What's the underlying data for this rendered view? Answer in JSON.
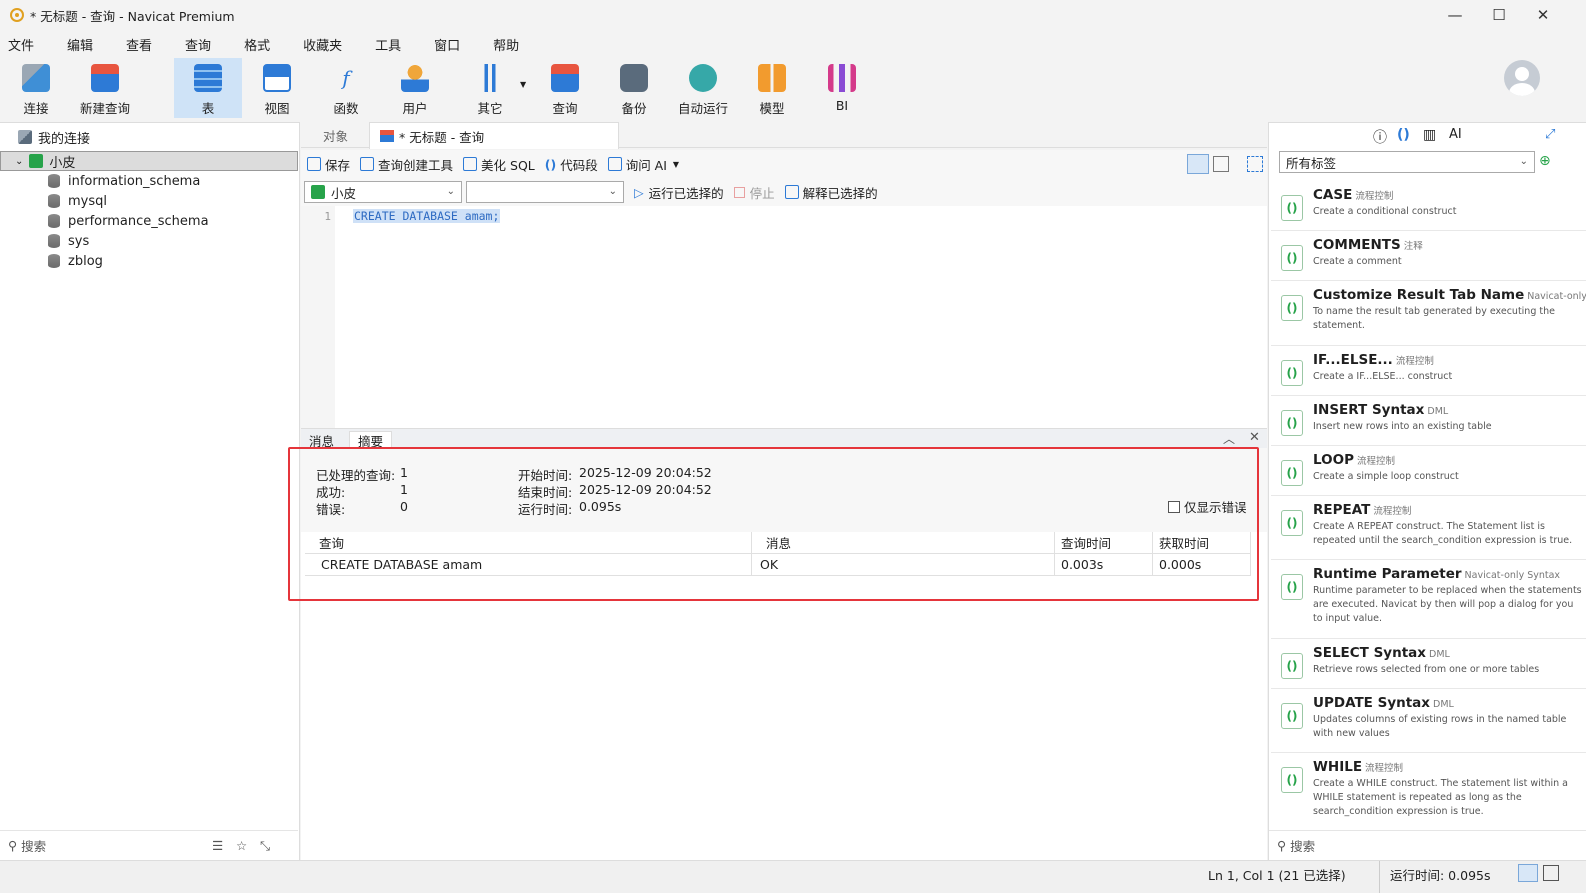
{
  "window": {
    "title": "* 无标题 - 查询 - Navicat Premium",
    "minimize": "—",
    "maximize": "☐",
    "close": "✕"
  },
  "menu": [
    "文件",
    "编辑",
    "查看",
    "查询",
    "格式",
    "收藏夹",
    "工具",
    "窗口",
    "帮助"
  ],
  "toolbar": [
    {
      "label": "连接",
      "color": "#3f8fd6"
    },
    {
      "label": "新建查询",
      "color": "#e8553f"
    },
    {
      "label": "表",
      "color": "#2d7ad6"
    },
    {
      "label": "视图",
      "color": "#2d7ad6"
    },
    {
      "label": "函数",
      "color": "#2d7ad6"
    },
    {
      "label": "用户",
      "color": "#f0a63a"
    },
    {
      "label": "其它",
      "color": "#2d7ad6"
    },
    {
      "label": "查询",
      "color": "#e8553f"
    },
    {
      "label": "备份",
      "color": "#5a6b7c"
    },
    {
      "label": "自动运行",
      "color": "#36a8a8"
    },
    {
      "label": "模型",
      "color": "#f29b2e"
    },
    {
      "label": "BI",
      "color": "#d43a8a"
    }
  ],
  "left": {
    "header": "我的连接",
    "connection": "小皮",
    "databases": [
      "information_schema",
      "mysql",
      "performance_schema",
      "sys",
      "zblog"
    ],
    "search_placeholder": "搜索"
  },
  "tabs": {
    "objects": "对象",
    "query": "* 无标题 - 查询"
  },
  "query_toolbar": {
    "save": "保存",
    "builder": "查询创建工具",
    "beautify": "美化 SQL",
    "snippet": "代码段",
    "ask_ai": "询问 AI"
  },
  "controls": {
    "connection": "小皮",
    "database": "",
    "run_selected": "运行已选择的",
    "stop": "停止",
    "explain": "解释已选择的"
  },
  "editor": {
    "line_number": "1",
    "code": "CREATE DATABASE amam;"
  },
  "result_tabs": {
    "messages": "消息",
    "summary": "摘要"
  },
  "summary": {
    "processed_label": "已处理的查询:",
    "processed": "1",
    "success_label": "成功:",
    "success": "1",
    "error_label": "错误:",
    "errors": "0",
    "start_label": "开始时间:",
    "start": "2025-12-09 20:04:52",
    "end_label": "结束时间:",
    "end": "2025-12-09 20:04:52",
    "elapsed_label": "运行时间:",
    "elapsed": "0.095s",
    "errors_only": "仅显示错误"
  },
  "result_table": {
    "headers": [
      "查询",
      "消息",
      "查询时间",
      "获取时间"
    ],
    "row": [
      "CREATE DATABASE amam",
      "OK",
      "0.003s",
      "0.000s"
    ]
  },
  "right": {
    "filter": "所有标签",
    "search_placeholder": "搜索",
    "snippets": [
      {
        "title": "CASE",
        "tag": "流程控制",
        "desc": "Create a conditional construct"
      },
      {
        "title": "COMMENTS",
        "tag": "注释",
        "desc": "Create a comment"
      },
      {
        "title": "Customize Result Tab Name",
        "tag": "Navicat-only Syntax",
        "desc": "To name the result tab generated by executing the statement."
      },
      {
        "title": "IF...ELSE...",
        "tag": "流程控制",
        "desc": "Create a IF...ELSE... construct"
      },
      {
        "title": "INSERT Syntax",
        "tag": "DML",
        "desc": "Insert new rows into an existing table"
      },
      {
        "title": "LOOP",
        "tag": "流程控制",
        "desc": "Create a simple loop construct"
      },
      {
        "title": "REPEAT",
        "tag": "流程控制",
        "desc": "Create A REPEAT construct. The Statement list is repeated until the search_condition expression is true."
      },
      {
        "title": "Runtime Parameter",
        "tag": "Navicat-only Syntax",
        "desc": "Runtime parameter to be replaced when the statements are executed. Navicat by then will pop a dialog for you to input value."
      },
      {
        "title": "SELECT Syntax",
        "tag": "DML",
        "desc": "Retrieve rows selected from one or more tables"
      },
      {
        "title": "UPDATE Syntax",
        "tag": "DML",
        "desc": "Updates columns of existing rows in the named table with new values"
      },
      {
        "title": "WHILE",
        "tag": "流程控制",
        "desc": "Create a WHILE construct. The statement list within a WHILE statement is repeated as long as the search_condition expression is true."
      }
    ]
  },
  "status": {
    "position": "Ln 1, Col 1 (21 已选择)",
    "elapsed": "运行时间: 0.095s"
  }
}
